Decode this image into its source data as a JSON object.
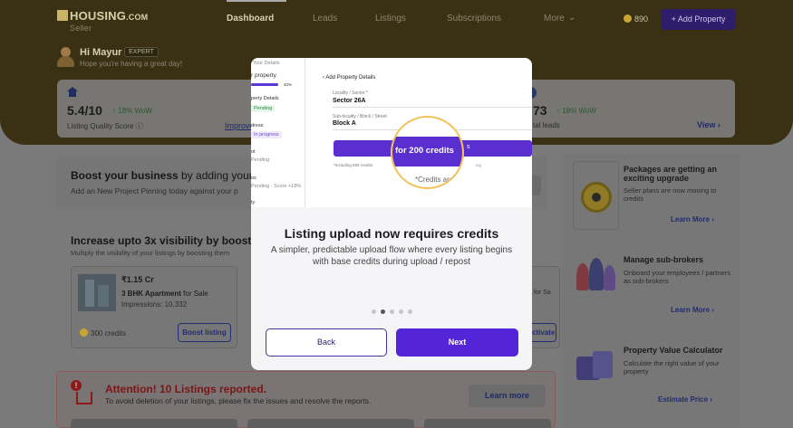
{
  "brand": {
    "name": "HOUSING",
    "suffix": ".COM",
    "sub": "Seller"
  },
  "nav": {
    "items": [
      "Dashboard",
      "Leads",
      "Listings",
      "Subscriptions",
      "More"
    ],
    "more_caret": "⌄"
  },
  "credits": "890",
  "add_property": "+ Add Property",
  "user": {
    "greeting": "Hi Mayur",
    "badge": "EXPERT",
    "message": "Hope you're having a great day!"
  },
  "stats": {
    "score": "5.4/10",
    "score_change": "↑ 18% WoW",
    "score_label": "Listing Quality Score ⓘ",
    "improve": "Improve",
    "leads": "73",
    "leads_change": "↑ 18% WoW",
    "leads_label": "tal leads",
    "view": "View ›"
  },
  "boost": {
    "title_bold": "Boost your business",
    "title_rest": " by adding your p",
    "subtitle": "Add an New Project Pinning today against your p"
  },
  "increase": {
    "title": "Increase upto 3x visibility by boostin",
    "subtitle": "Multiply the visibility of your listings by boosting them"
  },
  "listing": {
    "price": "₹1.15 Cr",
    "apt": "3 BHK Apartment",
    "apt_rest": " for Sale",
    "impressions": "Impressions: 10,332",
    "credits": "300 credits",
    "boost_btn": "Boost listing"
  },
  "listing2": {
    "sale": "for Sa",
    "btn": "ctivate"
  },
  "attention": {
    "icon": "!",
    "title": "Attention! 10 Listings reported.",
    "subtitle": "To avoid deletion of your listings, please fix the issues and resolve the reports.",
    "button": "Learn more"
  },
  "side": {
    "packages": {
      "title": "Packages are getting an exciting upgrade",
      "subtitle": "Seller plans are now moving to credits",
      "link": "Learn More ›"
    },
    "subbrokers": {
      "title": "Manage sub-brokers",
      "subtitle": "Onboard your employees / partners as sub-brokers",
      "link": "Learn More ›"
    },
    "calculator": {
      "title": "Property Value Calculator",
      "subtitle": "Calculate the right value of your property",
      "link": "Estimate Price ›"
    }
  },
  "modal": {
    "preview": {
      "side_items": [
        "Your Details",
        "r property",
        "40%",
        "perty Details",
        "Pending",
        "dress",
        "In progress",
        "ot",
        "Pending",
        "os",
        "Pending · Score +18%",
        "ty"
      ],
      "header": "‹  Add Property Details",
      "lbl1": "Locality / Sector *",
      "val1": "Sector 26A",
      "lbl2": "Sub-locality / Block / Street",
      "val2": "Block A",
      "button_text": "s",
      "tiny1": "*Including   890 credits",
      "tiny2": "ing"
    },
    "magnified": {
      "band": "for 200 credits",
      "foot": "*Credits are"
    },
    "title": "Listing upload now requires credits",
    "subtitle": "A simpler, predictable upload flow where every listing begins with base credits during upload / repost",
    "dots": {
      "total": 5,
      "active": 1
    },
    "back": "Back",
    "next": "Next"
  },
  "colors": {
    "accent": "#5424d8",
    "hero": "#3a3014",
    "alert": "#7c1515"
  }
}
